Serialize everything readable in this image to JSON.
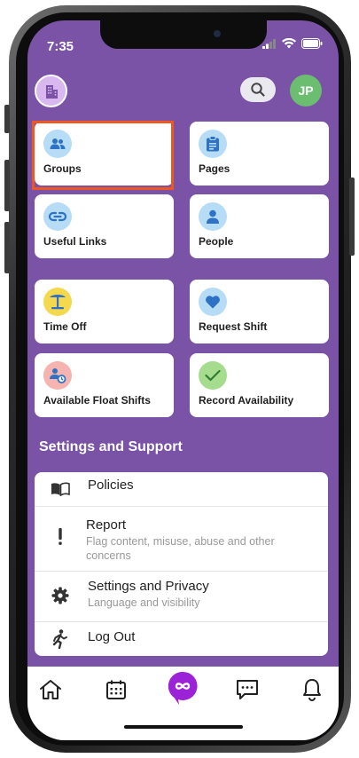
{
  "status_bar": {
    "time": "7:35"
  },
  "topbar": {
    "avatar_initials": "JP"
  },
  "tiles": [
    {
      "label": "Groups",
      "icon": "groups-icon",
      "icon_bg": "#b7dcf6"
    },
    {
      "label": "Pages",
      "icon": "pages-icon",
      "icon_bg": "#b7dcf6"
    },
    {
      "label": "Useful Links",
      "icon": "link-icon",
      "icon_bg": "#b7dcf6"
    },
    {
      "label": "People",
      "icon": "person-icon",
      "icon_bg": "#b7dcf6"
    },
    {
      "label": "Time Off",
      "icon": "palm-tree-icon",
      "icon_bg": "#f4d84e"
    },
    {
      "label": "Request Shift",
      "icon": "heart-icon",
      "icon_bg": "#b7dcf6"
    },
    {
      "label": "Available Float Shifts",
      "icon": "float-shift-icon",
      "icon_bg": "#f5b4b0"
    },
    {
      "label": "Record Availability",
      "icon": "check-icon",
      "icon_bg": "#a5dc8e"
    }
  ],
  "settings_section": {
    "title": "Settings and Support"
  },
  "menu": [
    {
      "title": "Policies",
      "icon": "book-icon"
    },
    {
      "title": "Report",
      "subtitle": "Flag content, misuse, abuse and other concerns",
      "icon": "exclamation-icon"
    },
    {
      "title": "Settings and Privacy",
      "subtitle": "Language and visibility",
      "icon": "gear-icon"
    },
    {
      "title": "Log Out",
      "icon": "logout-icon"
    }
  ],
  "bottom_nav": [
    "home-icon",
    "calendar-icon",
    "infinity-icon",
    "chat-icon",
    "bell-icon"
  ],
  "colors": {
    "background": "#7a52a6",
    "accent": "#9b22d6",
    "highlight": "#ee5722"
  }
}
